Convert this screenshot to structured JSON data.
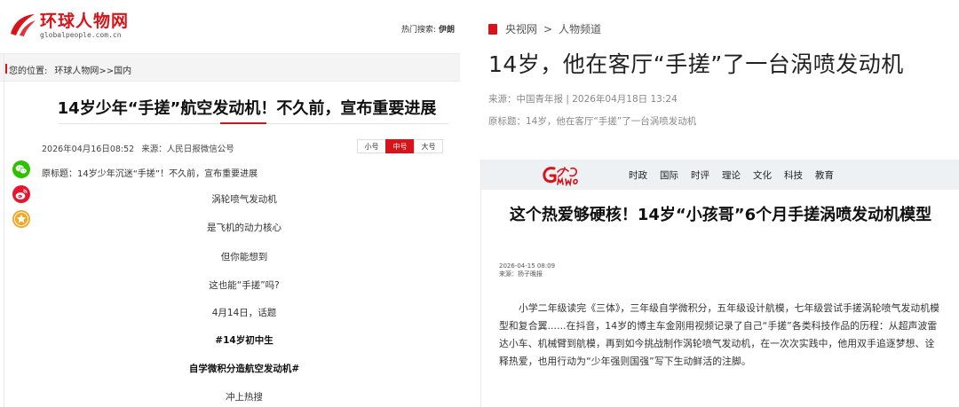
{
  "left_site": {
    "logo_text": "环球人物网",
    "logo_en": "globalpeople.com.cn",
    "hot_search_label": "热门搜索:",
    "hot_search_link": "伊朗",
    "breadcrumb": {
      "prefix": "您的位置:",
      "home": "环球人物网",
      "section": ">>国内"
    },
    "article": {
      "title": "14岁少年“手搓”航空发动机！不久前，宣布重要进展",
      "date": "2026年04月16日08:52",
      "source": "来源：人民日报微信公号",
      "font_sizes": [
        "小号",
        "中号",
        "大号"
      ],
      "font_size_selected": "中号",
      "original_title": "原标题：14岁少年沉迷“手搓”！不久前，宣布重要进展",
      "paragraphs": [
        {
          "text": "涡轮喷气发动机",
          "bold": false
        },
        {
          "text": "是飞机的动力核心",
          "bold": false
        },
        {
          "text": "但你能想到",
          "bold": false
        },
        {
          "text": "这也能“手搓”吗?",
          "bold": false
        },
        {
          "text": "4月14日，话题",
          "bold": false
        },
        {
          "text": "#14岁初中生",
          "bold": true
        },
        {
          "text": "自学微积分造航空发动机#",
          "bold": true
        },
        {
          "text": "冲上热搜",
          "bold": false
        }
      ]
    },
    "share_icons": [
      "wechat-icon",
      "weibo-icon",
      "favorite-icon"
    ],
    "colors": {
      "brand": "#d6141a",
      "wechat": "#2dc100",
      "weibo": "#e6162d",
      "favorite": "#f5a623"
    }
  },
  "right_site": {
    "breadcrumb": {
      "site": "央视网",
      "sep": ">",
      "channel": "人物频道"
    },
    "title": "14岁，他在客厅“手搓”了一台涡喷发动机",
    "source_line": "来源：中国青年报 | 2026年04月18日 13:24",
    "original_title": "原标题：14岁，他在客厅“手搓”了一台涡喷发动机",
    "embedded": {
      "logo": "光明网",
      "nav": [
        "时政",
        "国际",
        "时评",
        "理论",
        "文化",
        "科技",
        "教育"
      ],
      "title": "这个热爱够硬核！14岁“小孩哥”6个月手搓涡喷发动机模型",
      "date": "2026-04-15 08:09",
      "source": "来源：扬子晚报",
      "body": "小学二年级读完《三体》，三年级自学微积分，五年级设计航模，七年级尝试手搓涡轮喷气发动机模型和复合翼......在抖音，14岁的博主车金刚用视频记录了自己“手搓”各类科技作品的历程：从超声波雷达小车、机械臂到航模，再到如今挑战制作涡轮喷气发动机，在一次次实践中，他用双手追逐梦想、诠释热爱，也用行动为“少年强则国强”写下生动鲜活的注脚。"
    }
  }
}
